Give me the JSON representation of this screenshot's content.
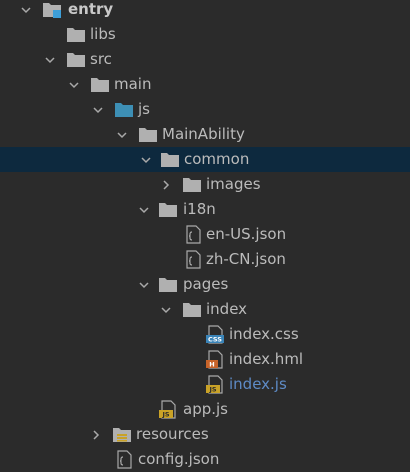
{
  "tree": {
    "entry": "entry",
    "libs": "libs",
    "src": "src",
    "main": "main",
    "js": "js",
    "main_ability": "MainAbility",
    "common": "common",
    "images": "images",
    "i18n": "i18n",
    "en_us": "en-US.json",
    "zh_cn": "zh-CN.json",
    "pages": "pages",
    "index_folder": "index",
    "index_css": "index.css",
    "index_hml": "index.hml",
    "index_js": "index.js",
    "app_js": "app.js",
    "resources": "resources",
    "config": "config.json"
  },
  "badges": {
    "css": "CSS",
    "hml": "H",
    "js": "JS"
  },
  "colors": {
    "background": "#2b2b2b",
    "selection": "#0d293e",
    "folder": "#b0b0b0",
    "js_folder": "#3d8fb5",
    "module_marker": "#3e9fd8",
    "css_badge": "#3a84b8",
    "hml_badge": "#c8642a",
    "js_badge": "#c9a227",
    "active_file_text": "#5e8bc6"
  },
  "icons": {
    "expanded": "chevron-down-icon",
    "collapsed": "chevron-right-icon",
    "folder": "folder-icon",
    "module": "module-folder-icon",
    "json": "json-file-icon",
    "css": "css-file-icon",
    "hml": "hml-file-icon",
    "js": "js-file-icon",
    "resources": "resources-folder-icon"
  }
}
